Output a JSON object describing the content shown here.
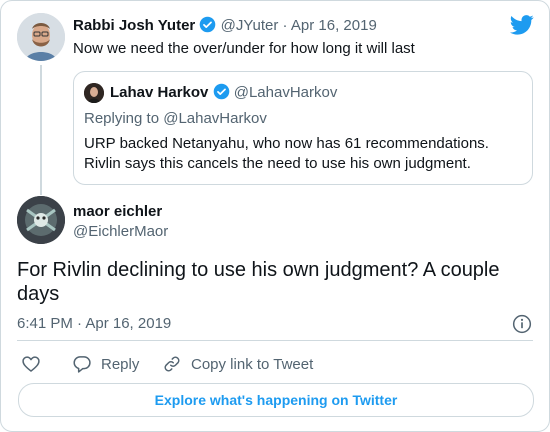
{
  "tweet": {
    "author_name": "Rabbi Josh Yuter",
    "author_handle": "@JYuter",
    "separator": "·",
    "date": "Apr 16, 2019",
    "text": "Now we need the over/under for how long it will last"
  },
  "quoted": {
    "author_name": "Lahav Harkov",
    "author_handle": "@LahavHarkov",
    "replying_to": "Replying to @LahavHarkov",
    "text_line1": "URP backed Netanyahu, who now has 61 recommendations.",
    "text_line2": "Rivlin says this cancels the need to use his own judgment."
  },
  "reply": {
    "author_name": "maor eichler",
    "author_handle": "@EichlerMaor",
    "text_line1": "For Rivlin declining to use his own judgment? A couple",
    "text_line2": "days",
    "timestamp": "6:41 PM · Apr 16, 2019"
  },
  "actions": {
    "reply_label": "Reply",
    "copy_label": "Copy link to Tweet"
  },
  "explore_button": "Explore what's happening on Twitter",
  "colors": {
    "accent": "#1d9bf0",
    "text": "#0f1419",
    "muted": "#536471",
    "border": "#cfd9de"
  },
  "icons": [
    "twitter-bird-icon",
    "verified-badge-icon",
    "info-icon",
    "heart-icon",
    "reply-icon",
    "copy-link-icon"
  ]
}
